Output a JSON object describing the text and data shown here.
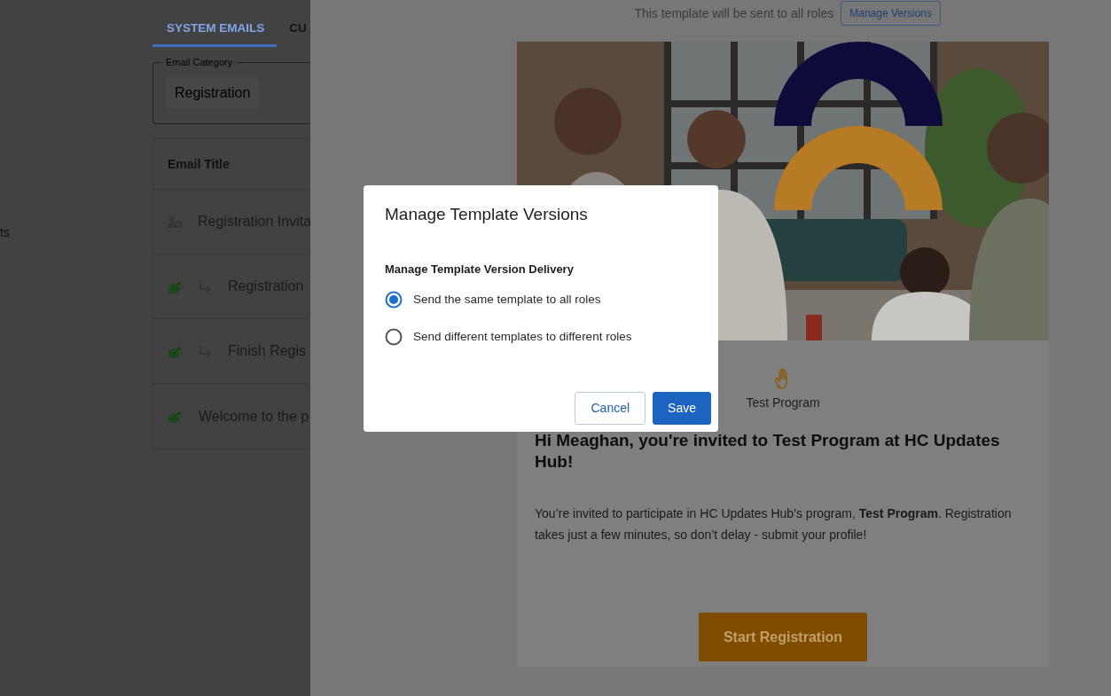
{
  "page": {
    "tabs": [
      {
        "label": "SYSTEM EMAILS",
        "selected": true
      },
      {
        "label": "CU",
        "selected": false
      }
    ],
    "sidebar_items": [
      "ts"
    ],
    "email_category": {
      "label": "Email Category",
      "value": "Registration"
    },
    "table": {
      "columns": [
        "Email Title"
      ],
      "rows": [
        {
          "kind": "role",
          "title": "Registration Invita",
          "children": [
            {
              "kind": "automated",
              "title": "Registration"
            },
            {
              "kind": "automated",
              "title": "Finish Regis"
            }
          ]
        },
        {
          "kind": "automated",
          "title": "Welcome to the p"
        }
      ]
    }
  },
  "drawer": {
    "notice": "This template will be sent to all roles",
    "manage_button": "Manage Versions",
    "email": {
      "program_name": "Test Program",
      "heading": "Hi Meaghan, you're invited to Test Program at HC Updates Hub!",
      "body": "You’re invited to participate in HC Updates Hub’s program, **Test Program**. Registration takes just a few minutes, so don’t delay - submit your profile!",
      "cta": "Start Registration"
    }
  },
  "modal": {
    "title": "Manage Template Versions",
    "section": "Manage Template Version Delivery",
    "options": [
      {
        "label": "Send the same template to all roles",
        "selected": true
      },
      {
        "label": "Send different templates to different roles",
        "selected": false
      }
    ],
    "buttons": [
      {
        "label": "Cancel",
        "kind": "outline"
      },
      {
        "label": "Save",
        "kind": "primary"
      }
    ]
  }
}
